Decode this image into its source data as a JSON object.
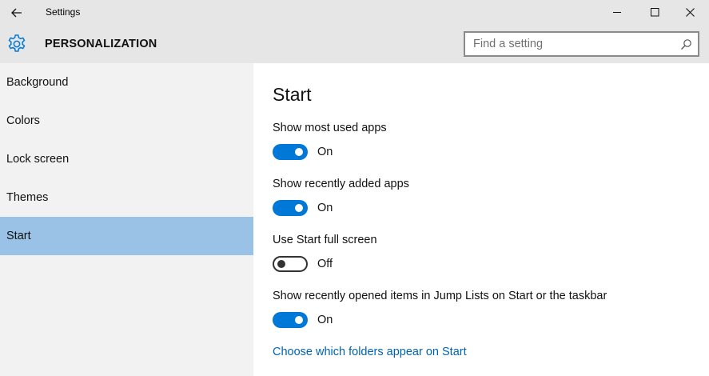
{
  "window": {
    "title": "Settings",
    "back_icon": "back-arrow-icon",
    "controls": [
      "minimize-icon",
      "maximize-icon",
      "close-icon"
    ]
  },
  "header": {
    "icon": "gear-icon",
    "title": "PERSONALIZATION",
    "search": {
      "placeholder": "Find a setting",
      "value": "",
      "icon": "search-icon"
    }
  },
  "sidebar": {
    "items": [
      {
        "label": "Background",
        "selected": false
      },
      {
        "label": "Colors",
        "selected": false
      },
      {
        "label": "Lock screen",
        "selected": false
      },
      {
        "label": "Themes",
        "selected": false
      },
      {
        "label": "Start",
        "selected": true
      }
    ]
  },
  "main": {
    "title": "Start",
    "settings": [
      {
        "label": "Show most used apps",
        "state": "On",
        "on": true
      },
      {
        "label": "Show recently added apps",
        "state": "On",
        "on": true
      },
      {
        "label": "Use Start full screen",
        "state": "Off",
        "on": false
      },
      {
        "label": "Show recently opened items in Jump Lists on Start or the taskbar",
        "state": "On",
        "on": true
      }
    ],
    "link": "Choose which folders appear on Start"
  },
  "colors": {
    "accent": "#0078d7",
    "selected_nav": "#99c2e6",
    "link": "#0063b1",
    "chrome": "#e6e6e6",
    "sidebar": "#f2f2f2"
  }
}
